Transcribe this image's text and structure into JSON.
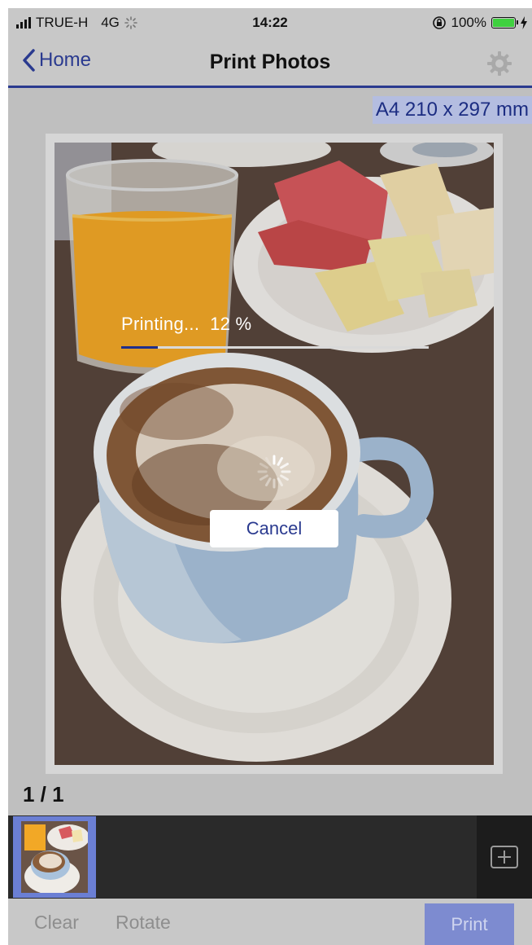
{
  "status_bar": {
    "carrier": "TRUE-H",
    "network": "4G",
    "time": "14:22",
    "battery": "100%",
    "icons": [
      "signal-icon",
      "activity-icon",
      "rotation-lock-icon",
      "battery-icon",
      "charging-icon"
    ]
  },
  "nav": {
    "back_label": "Home",
    "title": "Print Photos",
    "settings_icon": "gear-icon"
  },
  "paper": {
    "size_label": "A4 210 x 297 mm"
  },
  "print_progress": {
    "label": "Printing...",
    "percent_text": "12 %",
    "percent_value": 12,
    "cancel_label": "Cancel"
  },
  "pager": {
    "label": "1 / 1"
  },
  "toolbar": {
    "clear_label": "Clear",
    "rotate_label": "Rotate",
    "print_label": "Print"
  },
  "colors": {
    "accent": "#2a3a8f",
    "progress": "#1f2f8c",
    "thumb_selected": "#6b7fd4",
    "print_button": "#7d8bd0"
  }
}
